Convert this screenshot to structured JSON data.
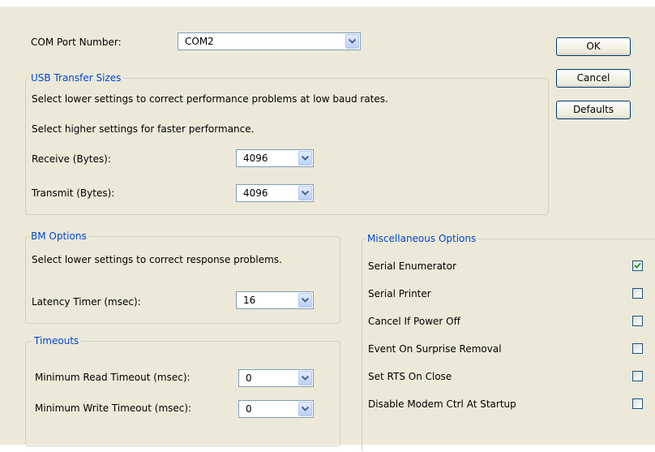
{
  "com_port": {
    "label": "COM Port Number:",
    "value": "COM2"
  },
  "buttons": {
    "ok": "OK",
    "cancel": "Cancel",
    "defaults": "Defaults"
  },
  "usb": {
    "title": "USB Transfer Sizes",
    "desc1": "Select lower settings to correct performance problems at low baud rates.",
    "desc2": "Select higher settings for faster performance.",
    "receive_label": "Receive (Bytes):",
    "receive_value": "4096",
    "transmit_label": "Transmit (Bytes):",
    "transmit_value": "4096"
  },
  "bm": {
    "title": "BM Options",
    "desc": "Select lower settings to correct response problems.",
    "latency_label": "Latency Timer (msec):",
    "latency_value": "16"
  },
  "timeouts": {
    "title": "Timeouts",
    "read_label": "Minimum Read Timeout (msec):",
    "read_value": "0",
    "write_label": "Minimum Write Timeout (msec):",
    "write_value": "0"
  },
  "misc": {
    "title": "Miscellaneous Options",
    "options": [
      {
        "label": "Serial Enumerator",
        "checked": true
      },
      {
        "label": "Serial Printer",
        "checked": false
      },
      {
        "label": "Cancel If Power Off",
        "checked": false
      },
      {
        "label": "Event On Surprise Removal",
        "checked": false
      },
      {
        "label": "Set RTS On Close",
        "checked": false
      },
      {
        "label": "Disable Modem Ctrl At Startup",
        "checked": false
      }
    ]
  },
  "colors": {
    "group_title": "#0046d5",
    "check": "#21a121"
  }
}
